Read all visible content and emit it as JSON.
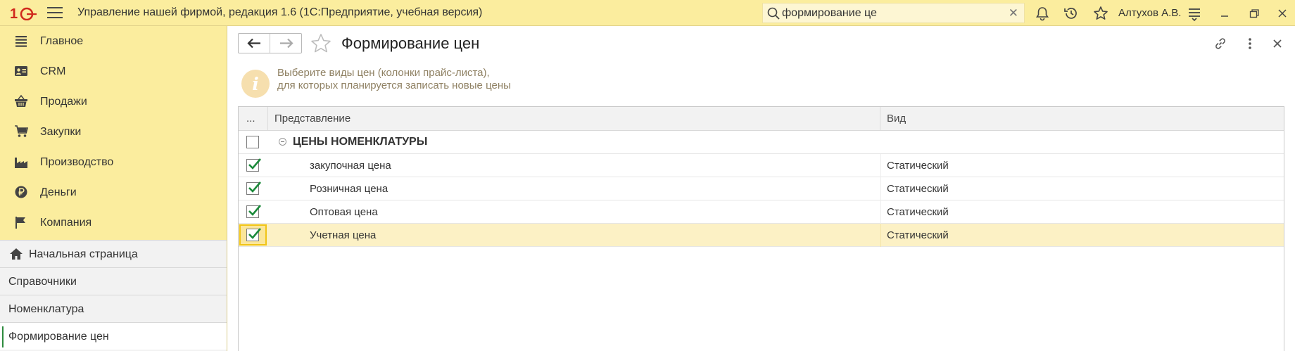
{
  "app": {
    "title": "Управление нашей фирмой, редакция 1.6  (1С:Предприятие, учебная версия)",
    "search_value": "формирование це",
    "user": "Алтухов А.В."
  },
  "sidebar": {
    "sections": [
      {
        "label": "Главное",
        "icon": "list-icon"
      },
      {
        "label": "CRM",
        "icon": "contact-card-icon"
      },
      {
        "label": "Продажи",
        "icon": "basket-icon"
      },
      {
        "label": "Закупки",
        "icon": "cart-icon"
      },
      {
        "label": "Производство",
        "icon": "factory-icon"
      },
      {
        "label": "Деньги",
        "icon": "ruble-coin-icon"
      },
      {
        "label": "Компания",
        "icon": "flag-icon"
      }
    ],
    "open_windows": [
      {
        "label": "Начальная страница",
        "icon": "home-icon"
      },
      {
        "label": "Справочники"
      },
      {
        "label": "Номенклатура"
      },
      {
        "label": "Формирование цен",
        "active": true
      }
    ]
  },
  "form": {
    "title": "Формирование цен",
    "info_line1": "Выберите виды цен (колонки прайс-листа),",
    "info_line2": "для которых планируется записать новые цены"
  },
  "table": {
    "columns": [
      "...",
      "Представление",
      "Вид"
    ],
    "group": {
      "label": "ЦЕНЫ НОМЕНКЛАТУРЫ",
      "checked": false
    },
    "rows": [
      {
        "name": "закупочная цена",
        "kind": "Статический",
        "checked": true
      },
      {
        "name": "Розничная цена",
        "kind": "Статический",
        "checked": true
      },
      {
        "name": "Оптовая цена",
        "kind": "Статический",
        "checked": true
      },
      {
        "name": "Учетная цена",
        "kind": "Статический",
        "checked": true,
        "selected": true
      }
    ]
  },
  "colors": {
    "accent_yellow": "#fbed9e",
    "selected_row": "#fcf1c5",
    "check_green": "#1b8a3a",
    "active_marker": "#2c8a3d"
  }
}
